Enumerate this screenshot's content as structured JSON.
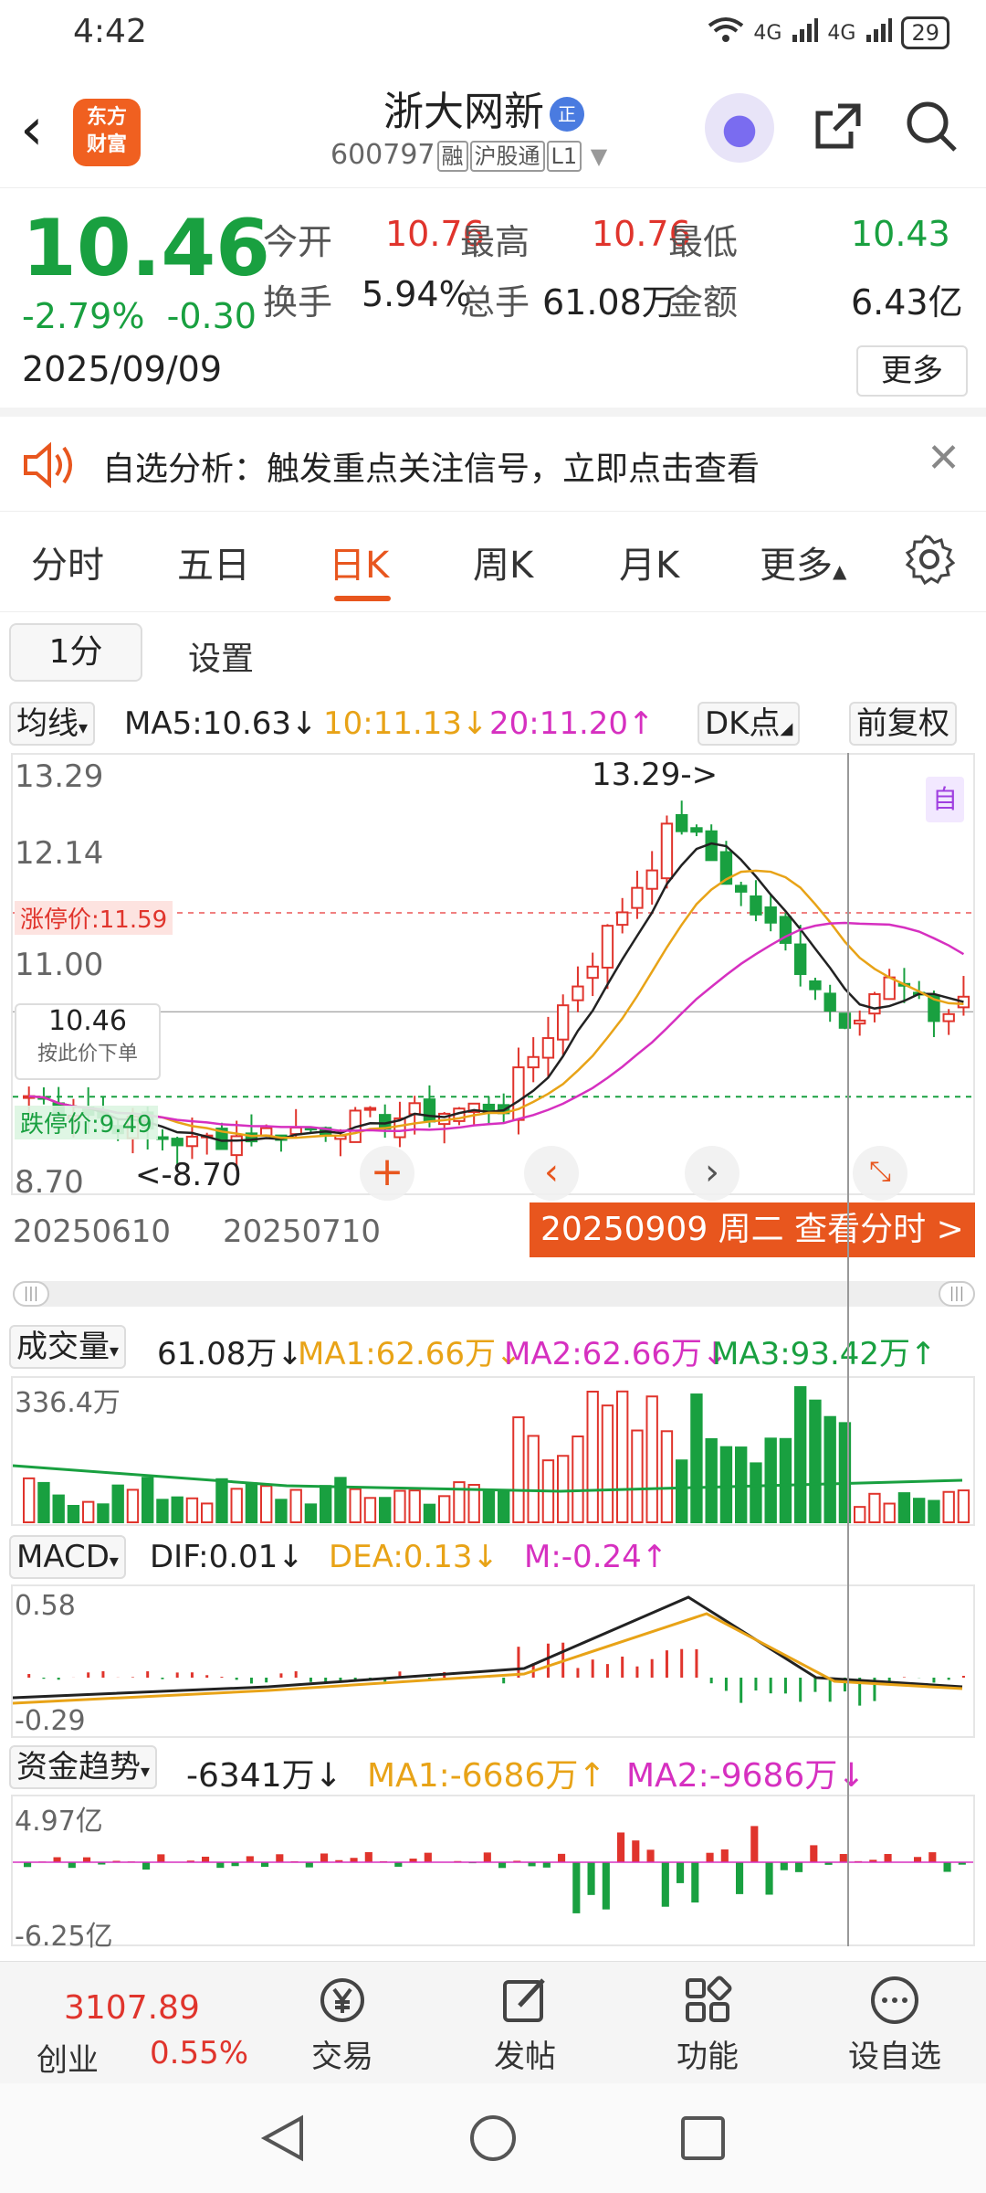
{
  "status_bar": {
    "time": "4:42",
    "signal1": "4G",
    "signal2": "4G",
    "battery": "29"
  },
  "header": {
    "logo_line1": "东方",
    "logo_line2": "财富",
    "stock_name": "浙大网新",
    "name_badge": "正",
    "stock_code": "600797",
    "tag_margin": "融",
    "tag_connect": "沪股通",
    "tag_level": "L1"
  },
  "quote": {
    "price": "10.46",
    "change_pct": "-2.79%",
    "change_amt": "-0.30",
    "date": "2025/09/09",
    "open_label": "今开",
    "open": "10.76",
    "high_label": "最高",
    "high": "10.76",
    "low_label": "最低",
    "low": "10.43",
    "turnover_label": "换手",
    "turnover": "5.94%",
    "volume_label": "总手",
    "volume": "61.08万",
    "amount_label": "金额",
    "amount": "6.43亿",
    "more_label": "更多",
    "colors": {
      "down": "#19a040",
      "up": "#e0342c",
      "accent": "#e8561e"
    }
  },
  "notice": {
    "text": "自选分析：触发重点关注信号，立即点击查看"
  },
  "tabs": [
    {
      "label": "分时"
    },
    {
      "label": "五日"
    },
    {
      "label": "日K"
    },
    {
      "label": "周K"
    },
    {
      "label": "月K"
    },
    {
      "label": "更多"
    }
  ],
  "subtabs": {
    "interval": "1分",
    "settings": "设置"
  },
  "ma_row": {
    "selector": "均线",
    "ma5": "MA5:10.63↓",
    "ma10": "10:11.13↓",
    "ma20": "20:11.20↑",
    "dk": "DK点",
    "adjust": "前复权"
  },
  "kline": {
    "y_top": "13.29",
    "y_mid": "12.14",
    "y_11": "11.00",
    "y_bottom": "8.70",
    "max_annotation": "13.29->",
    "min_annotation": "<-8.70",
    "limit_up": "涨停价:11.59",
    "limit_down": "跌停价:9.49",
    "current_price_label": "10.46",
    "order_hint": "按此价下单",
    "self_marker": "自",
    "watermark": "东方财富",
    "td_marks": [
      "1",
      "23",
      "4",
      "5",
      "6",
      "7",
      "8",
      "9",
      "12",
      "4",
      "5",
      "6",
      "7",
      "8",
      "9",
      "3",
      "6",
      "7",
      "12",
      "5",
      "9"
    ],
    "dates": [
      "20250610",
      "20250710"
    ],
    "view_detail": "20250909 周二 查看分时 >"
  },
  "volume": {
    "selector": "成交量",
    "value": "61.08万↓",
    "ma1": "MA1:62.66万↓",
    "ma2": "MA2:62.66万↓",
    "ma3": "MA3:93.42万↑",
    "y_max": "336.4万"
  },
  "macd": {
    "selector": "MACD",
    "dif": "DIF:0.01↓",
    "dea": "DEA:0.13↓",
    "m": "M:-0.24↑",
    "y_max": "0.58",
    "y_min": "-0.29"
  },
  "fund": {
    "selector": "资金趋势",
    "value": "-6341万↓",
    "ma1": "MA1:-6686万↑",
    "ma2": "MA2:-9686万↓",
    "y_max": "4.97亿",
    "y_min": "-6.25亿"
  },
  "bottom_nav": {
    "index_value": "3107.89",
    "index_name": "创业",
    "index_change": "0.55%",
    "items": [
      {
        "label": "交易"
      },
      {
        "label": "发帖"
      },
      {
        "label": "功能"
      },
      {
        "label": "设自选"
      }
    ]
  }
}
